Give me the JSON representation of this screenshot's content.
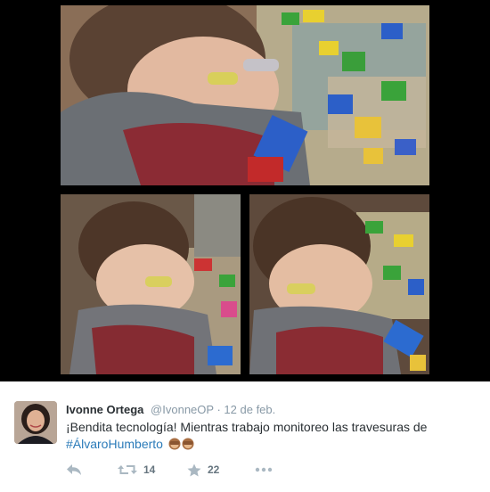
{
  "tweet": {
    "name": "Ivonne Ortega",
    "handle": "@IvonneOP",
    "separator": "·",
    "date": "12 de feb.",
    "text": "¡Bendita tecnología! Mientras trabajo monitoreo las travesuras de",
    "hashtag": "#ÁlvaroHumberto",
    "emoji": "🙈🙈"
  },
  "actions": {
    "reply_icon": "reply-icon",
    "retweet_icon": "retweet-icon",
    "retweet_count": "14",
    "favorite_icon": "star-icon",
    "favorite_count": "22",
    "more_icon": "more-dots-icon"
  },
  "colors": {
    "name": "#292f33",
    "meta": "#8899a6",
    "link": "#2b7bb9",
    "letterbox": "#000000"
  }
}
